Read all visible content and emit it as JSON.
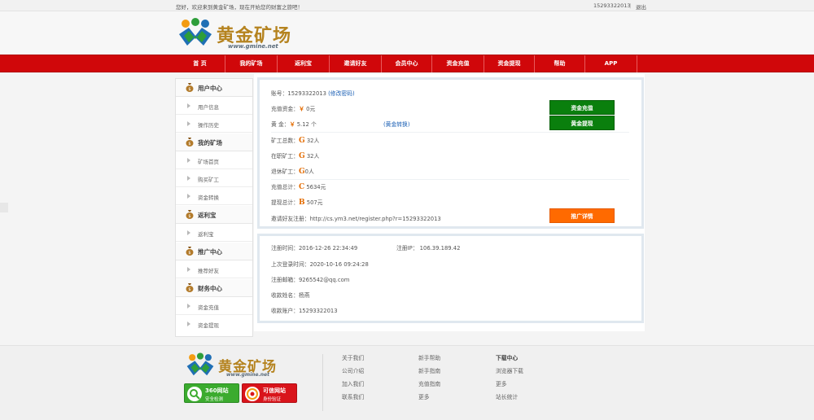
{
  "topbar": {
    "welcome": "您好，欢迎来到黄金矿场，现在开始您的财富之旅吧！",
    "account": "15293322013",
    "separator": "|",
    "logout": "退出"
  },
  "logo": {
    "name": "黄金矿场",
    "domain": "www.gmine.net"
  },
  "nav": [
    "首 页",
    "我的矿场",
    "返利宝",
    "邀请好友",
    "会员中心",
    "资金充值",
    "资金提现",
    "帮助",
    "APP"
  ],
  "sidebar": {
    "sections": [
      {
        "title": "用户中心",
        "items": [
          "用户信息",
          "操作历史"
        ]
      },
      {
        "title": "我的矿场",
        "items": [
          "矿场首页",
          "购买矿工",
          "资金转换"
        ]
      },
      {
        "title": "返利宝",
        "items": [
          "返利宝"
        ]
      },
      {
        "title": "推广中心",
        "items": [
          "推荐好友"
        ]
      },
      {
        "title": "财务中心",
        "items": [
          "资金充值",
          "资金提现"
        ]
      }
    ]
  },
  "account_panel": {
    "account_label": "账号：",
    "account_value": "15293322013",
    "change_password": "(修改密码)",
    "recharge_label": "充值资金：",
    "recharge_value": "0元",
    "yen": "￥",
    "gold_label": "黄      金：",
    "gold_value": "5.12 个",
    "gold_convert": "(黄金转换)",
    "miners_total_label": "矿工总数：",
    "miners_total_value": "32人",
    "miners_active_label": "在职矿工：",
    "miners_active_value": "32人",
    "miners_retired_label": "退休矿工：",
    "miners_retired_value": "0人",
    "g_icon": "G",
    "recharge_total_label": "充值总计：",
    "recharge_total_value": "5634元",
    "c_icon": "C",
    "withdraw_total_label": "提现总计：",
    "withdraw_total_value": "507元",
    "b_icon": "B",
    "invite_label": "邀请好友注册：",
    "invite_url": "http://cs.ym3.net/register.php?r=15293322013",
    "btn_recharge": "资金充值",
    "btn_withdraw": "黄金提现",
    "btn_promo": "推广详情"
  },
  "info_panel": {
    "reg_time_label": "注册时间：",
    "reg_time_value": "2016-12-26 22:34:49",
    "reg_ip_label": "注册IP：",
    "reg_ip_value": "106.39.189.42",
    "last_login_label": "上次登录时间：",
    "last_login_value": "2020-10-16 09:24:28",
    "email_label": "注册邮箱：",
    "email_value": "9265542@qq.com",
    "payee_label": "收款姓名：",
    "payee_value": "杨燕",
    "payee_account_label": "收款账户：",
    "payee_account_value": "15293322013"
  },
  "footer": {
    "badge1_line1": "360网站",
    "badge1_line2": "安全检测",
    "badge2_line1": "可信网站",
    "badge2_line2": "身份验证",
    "col1": [
      "关于我们",
      "公司介绍",
      "加入我们",
      "联系我们"
    ],
    "col2": [
      "新手帮助",
      "新手指南",
      "充值指南",
      "更多"
    ],
    "col3_title": "下载中心",
    "col3": [
      "浏览器下载",
      "更多",
      "站长统计"
    ]
  },
  "colors": {
    "nav_red": "#d0070a",
    "btn_green": "#0a7f0d",
    "btn_orange": "#ff6a00",
    "gold": "#b5831f"
  }
}
